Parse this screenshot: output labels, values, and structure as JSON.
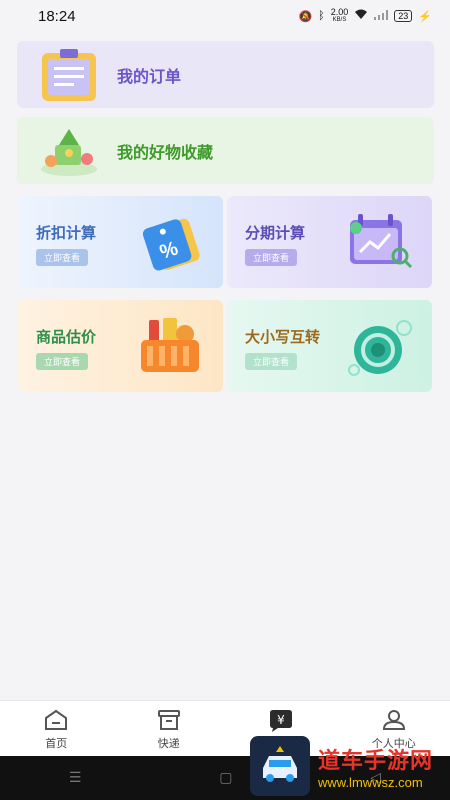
{
  "status_bar": {
    "time": "18:24",
    "net_speed": "2.00",
    "net_unit": "KB/S",
    "battery": "23"
  },
  "banners": {
    "orders": {
      "title": "我的订单",
      "icon": "clipboard-icon"
    },
    "favorites": {
      "title": "我的好物收藏",
      "icon": "gift-basket-icon"
    }
  },
  "cards": [
    {
      "title": "折扣计算",
      "button": "立即查看",
      "icon": "percent-tag-icon"
    },
    {
      "title": "分期计算",
      "button": "立即查看",
      "icon": "calendar-chart-icon"
    },
    {
      "title": "商品估价",
      "button": "立即查看",
      "icon": "shopping-basket-icon"
    },
    {
      "title": "大小写互转",
      "button": "立即查看",
      "icon": "coin-swap-icon"
    }
  ],
  "tabbar": {
    "items": [
      {
        "label": "首页",
        "icon": "home-icon"
      },
      {
        "label": "快递",
        "icon": "box-icon"
      },
      {
        "label": "",
        "icon": "yen-chat-icon"
      },
      {
        "label": "个人中心",
        "icon": "user-icon"
      }
    ]
  },
  "watermark": {
    "main": "道车手游网",
    "url": "www.lmwwsz.com"
  }
}
